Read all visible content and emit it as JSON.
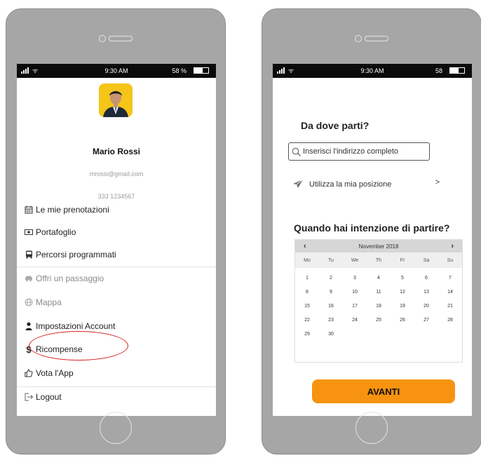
{
  "left_phone": {
    "status": {
      "time": "9:30 AM",
      "battery": "58 %",
      "battery_level": 0.58
    },
    "profile": {
      "name": "Mario Rossi",
      "email": "mrossi@gmail.com",
      "phone": "333 1234567"
    },
    "menu": [
      {
        "label": "Le mie prenotazioni",
        "icon": "calendar-icon"
      },
      {
        "label": "Portafoglio",
        "icon": "wallet-icon"
      },
      {
        "label": "Percorsi programmati",
        "icon": "bus-icon"
      },
      {
        "label": "Offri un passaggio",
        "icon": "car-icon"
      },
      {
        "label": "Mappa",
        "icon": "globe-icon"
      },
      {
        "label": "Impostazioni Account",
        "icon": "user-icon"
      },
      {
        "label": "Ricompense",
        "icon": "dollar-icon"
      },
      {
        "label": "Vota l'App",
        "icon": "thumbs-up-icon"
      },
      {
        "label": "Logout",
        "icon": "logout-icon"
      }
    ],
    "highlight_color": "#d42020"
  },
  "right_phone": {
    "status": {
      "time": "9:30 AM",
      "battery": "58"
    },
    "question_from": "Da dove parti?",
    "search_placeholder": "Inserisci l'indirizzo completo",
    "use_location": "Utilizza la mia posizione",
    "use_location_arrow": ">",
    "question_when": "Quando hai intenzione di partire?",
    "calendar": {
      "month": "November 2018",
      "prev": "‹",
      "next": "›",
      "weekdays": [
        "Mo",
        "Tu",
        "We",
        "Th",
        "Fr",
        "Sa",
        "Su"
      ],
      "days": [
        "1",
        "2",
        "3",
        "4",
        "5",
        "6",
        "7",
        "8",
        "9",
        "10",
        "11",
        "12",
        "13",
        "14",
        "15",
        "16",
        "17",
        "18",
        "19",
        "20",
        "21",
        "22",
        "23",
        "24",
        "25",
        "26",
        "27",
        "28",
        "29",
        "30"
      ]
    },
    "next_button": "AVANTI",
    "accent_color": "#f7930f"
  }
}
